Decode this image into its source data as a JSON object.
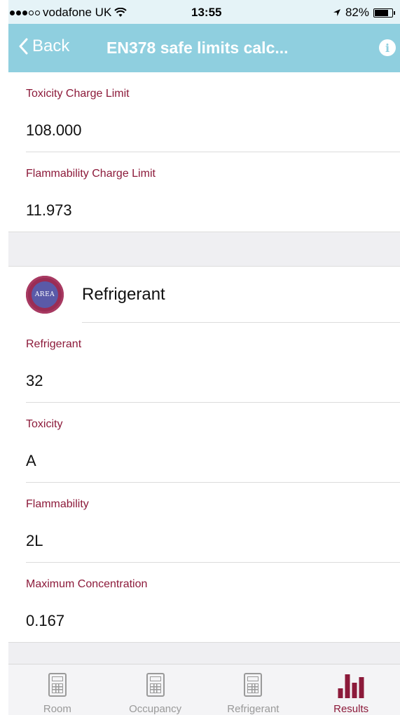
{
  "status_bar": {
    "carrier": "vodafone UK",
    "time": "13:55",
    "battery": "82%",
    "battery_level": 0.82
  },
  "nav": {
    "back_label": "Back",
    "title": "EN378 safe limits calc...",
    "info_glyph": "i"
  },
  "limits": [
    {
      "label": "Toxicity Charge Limit",
      "value": "108.000"
    },
    {
      "label": "Flammability Charge Limit",
      "value": "11.973"
    }
  ],
  "refrigerant_section": {
    "logo_text": "AREA",
    "title": "Refrigerant",
    "fields": [
      {
        "label": "Refrigerant",
        "value": "32"
      },
      {
        "label": "Toxicity",
        "value": "A"
      },
      {
        "label": "Flammability",
        "value": "2L"
      },
      {
        "label": "Maximum Concentration",
        "value": "0.167"
      }
    ]
  },
  "tabs": [
    {
      "label": "Room",
      "icon": "calculator-icon",
      "active": false
    },
    {
      "label": "Occupancy",
      "icon": "calculator-icon",
      "active": false
    },
    {
      "label": "Refrigerant",
      "icon": "calculator-icon",
      "active": false
    },
    {
      "label": "Results",
      "icon": "bar-chart-icon",
      "active": true
    }
  ],
  "colors": {
    "accent": "#8c1a3a",
    "nav_bg": "#8fcfdf",
    "status_bg": "#e5f3f7"
  }
}
